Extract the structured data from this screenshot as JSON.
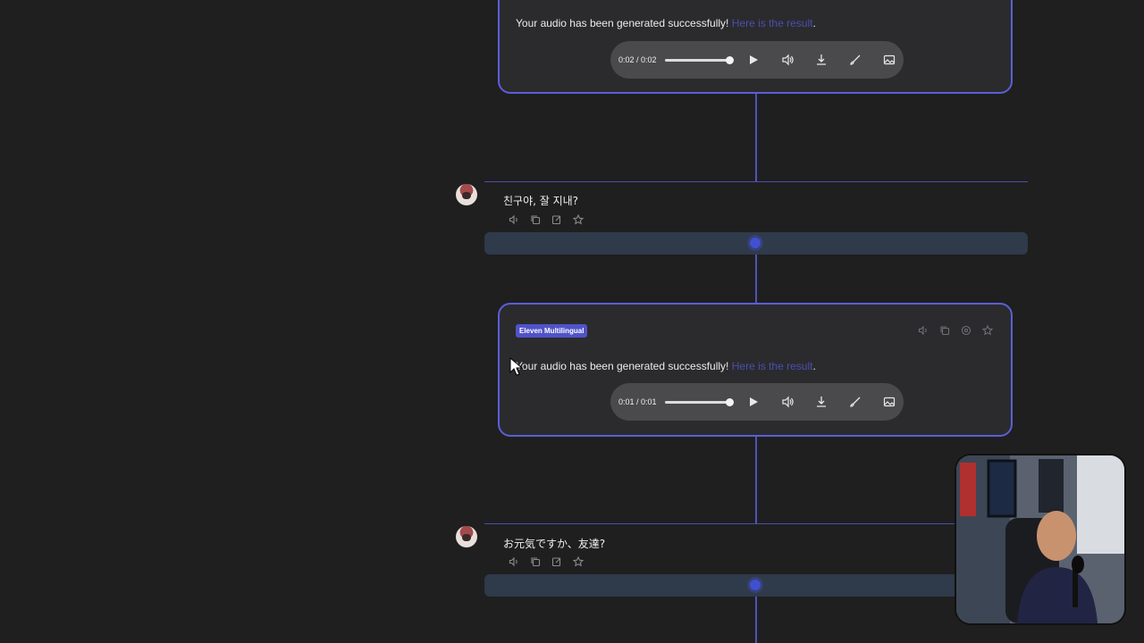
{
  "card1": {
    "message": "Your audio has been generated successfully!",
    "link_text": "Here is the result",
    "suffix": ".",
    "player": {
      "time": "0:02 / 0:02"
    }
  },
  "user1": {
    "text": "친구야, 잘 지내?"
  },
  "card2": {
    "badge": "Eleven Multilingual",
    "message": "Your audio has been generated successfully!",
    "link_text": "Here is the result",
    "suffix": ".",
    "player": {
      "time": "0:01 / 0:01"
    }
  },
  "user2": {
    "text": "お元気ですか、友達?"
  },
  "colors": {
    "background": "#1f1f1f",
    "card_border": "#5a5fd6",
    "badge": "#5053c9",
    "connector": "#4f54b8",
    "link": "#4a4fae"
  }
}
